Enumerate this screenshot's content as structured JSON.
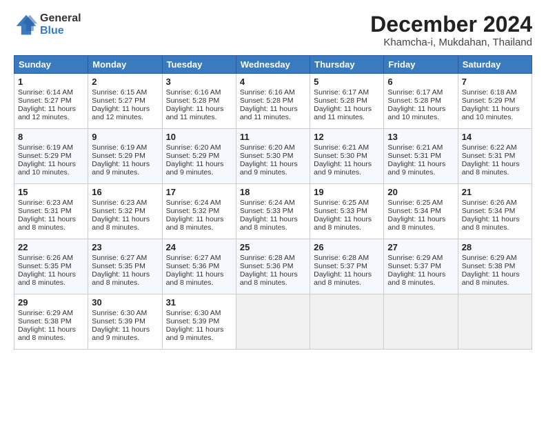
{
  "logo": {
    "general": "General",
    "blue": "Blue"
  },
  "title": "December 2024",
  "location": "Khamcha-i, Mukdahan, Thailand",
  "days_of_week": [
    "Sunday",
    "Monday",
    "Tuesday",
    "Wednesday",
    "Thursday",
    "Friday",
    "Saturday"
  ],
  "weeks": [
    [
      {
        "day": "1",
        "sunrise": "Sunrise: 6:14 AM",
        "sunset": "Sunset: 5:27 PM",
        "daylight": "Daylight: 11 hours and 12 minutes."
      },
      {
        "day": "2",
        "sunrise": "Sunrise: 6:15 AM",
        "sunset": "Sunset: 5:27 PM",
        "daylight": "Daylight: 11 hours and 12 minutes."
      },
      {
        "day": "3",
        "sunrise": "Sunrise: 6:16 AM",
        "sunset": "Sunset: 5:28 PM",
        "daylight": "Daylight: 11 hours and 11 minutes."
      },
      {
        "day": "4",
        "sunrise": "Sunrise: 6:16 AM",
        "sunset": "Sunset: 5:28 PM",
        "daylight": "Daylight: 11 hours and 11 minutes."
      },
      {
        "day": "5",
        "sunrise": "Sunrise: 6:17 AM",
        "sunset": "Sunset: 5:28 PM",
        "daylight": "Daylight: 11 hours and 11 minutes."
      },
      {
        "day": "6",
        "sunrise": "Sunrise: 6:17 AM",
        "sunset": "Sunset: 5:28 PM",
        "daylight": "Daylight: 11 hours and 10 minutes."
      },
      {
        "day": "7",
        "sunrise": "Sunrise: 6:18 AM",
        "sunset": "Sunset: 5:29 PM",
        "daylight": "Daylight: 11 hours and 10 minutes."
      }
    ],
    [
      {
        "day": "8",
        "sunrise": "Sunrise: 6:19 AM",
        "sunset": "Sunset: 5:29 PM",
        "daylight": "Daylight: 11 hours and 10 minutes."
      },
      {
        "day": "9",
        "sunrise": "Sunrise: 6:19 AM",
        "sunset": "Sunset: 5:29 PM",
        "daylight": "Daylight: 11 hours and 9 minutes."
      },
      {
        "day": "10",
        "sunrise": "Sunrise: 6:20 AM",
        "sunset": "Sunset: 5:29 PM",
        "daylight": "Daylight: 11 hours and 9 minutes."
      },
      {
        "day": "11",
        "sunrise": "Sunrise: 6:20 AM",
        "sunset": "Sunset: 5:30 PM",
        "daylight": "Daylight: 11 hours and 9 minutes."
      },
      {
        "day": "12",
        "sunrise": "Sunrise: 6:21 AM",
        "sunset": "Sunset: 5:30 PM",
        "daylight": "Daylight: 11 hours and 9 minutes."
      },
      {
        "day": "13",
        "sunrise": "Sunrise: 6:21 AM",
        "sunset": "Sunset: 5:31 PM",
        "daylight": "Daylight: 11 hours and 9 minutes."
      },
      {
        "day": "14",
        "sunrise": "Sunrise: 6:22 AM",
        "sunset": "Sunset: 5:31 PM",
        "daylight": "Daylight: 11 hours and 8 minutes."
      }
    ],
    [
      {
        "day": "15",
        "sunrise": "Sunrise: 6:23 AM",
        "sunset": "Sunset: 5:31 PM",
        "daylight": "Daylight: 11 hours and 8 minutes."
      },
      {
        "day": "16",
        "sunrise": "Sunrise: 6:23 AM",
        "sunset": "Sunset: 5:32 PM",
        "daylight": "Daylight: 11 hours and 8 minutes."
      },
      {
        "day": "17",
        "sunrise": "Sunrise: 6:24 AM",
        "sunset": "Sunset: 5:32 PM",
        "daylight": "Daylight: 11 hours and 8 minutes."
      },
      {
        "day": "18",
        "sunrise": "Sunrise: 6:24 AM",
        "sunset": "Sunset: 5:33 PM",
        "daylight": "Daylight: 11 hours and 8 minutes."
      },
      {
        "day": "19",
        "sunrise": "Sunrise: 6:25 AM",
        "sunset": "Sunset: 5:33 PM",
        "daylight": "Daylight: 11 hours and 8 minutes."
      },
      {
        "day": "20",
        "sunrise": "Sunrise: 6:25 AM",
        "sunset": "Sunset: 5:34 PM",
        "daylight": "Daylight: 11 hours and 8 minutes."
      },
      {
        "day": "21",
        "sunrise": "Sunrise: 6:26 AM",
        "sunset": "Sunset: 5:34 PM",
        "daylight": "Daylight: 11 hours and 8 minutes."
      }
    ],
    [
      {
        "day": "22",
        "sunrise": "Sunrise: 6:26 AM",
        "sunset": "Sunset: 5:35 PM",
        "daylight": "Daylight: 11 hours and 8 minutes."
      },
      {
        "day": "23",
        "sunrise": "Sunrise: 6:27 AM",
        "sunset": "Sunset: 5:35 PM",
        "daylight": "Daylight: 11 hours and 8 minutes."
      },
      {
        "day": "24",
        "sunrise": "Sunrise: 6:27 AM",
        "sunset": "Sunset: 5:36 PM",
        "daylight": "Daylight: 11 hours and 8 minutes."
      },
      {
        "day": "25",
        "sunrise": "Sunrise: 6:28 AM",
        "sunset": "Sunset: 5:36 PM",
        "daylight": "Daylight: 11 hours and 8 minutes."
      },
      {
        "day": "26",
        "sunrise": "Sunrise: 6:28 AM",
        "sunset": "Sunset: 5:37 PM",
        "daylight": "Daylight: 11 hours and 8 minutes."
      },
      {
        "day": "27",
        "sunrise": "Sunrise: 6:29 AM",
        "sunset": "Sunset: 5:37 PM",
        "daylight": "Daylight: 11 hours and 8 minutes."
      },
      {
        "day": "28",
        "sunrise": "Sunrise: 6:29 AM",
        "sunset": "Sunset: 5:38 PM",
        "daylight": "Daylight: 11 hours and 8 minutes."
      }
    ],
    [
      {
        "day": "29",
        "sunrise": "Sunrise: 6:29 AM",
        "sunset": "Sunset: 5:38 PM",
        "daylight": "Daylight: 11 hours and 8 minutes."
      },
      {
        "day": "30",
        "sunrise": "Sunrise: 6:30 AM",
        "sunset": "Sunset: 5:39 PM",
        "daylight": "Daylight: 11 hours and 9 minutes."
      },
      {
        "day": "31",
        "sunrise": "Sunrise: 6:30 AM",
        "sunset": "Sunset: 5:39 PM",
        "daylight": "Daylight: 11 hours and 9 minutes."
      },
      null,
      null,
      null,
      null
    ]
  ]
}
